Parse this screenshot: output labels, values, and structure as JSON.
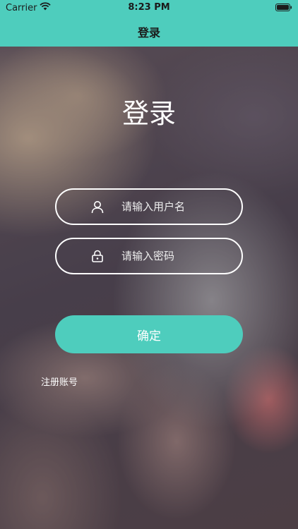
{
  "status_bar": {
    "carrier": "Carrier",
    "time": "8:23 PM"
  },
  "nav": {
    "title": "登录"
  },
  "login": {
    "heading": "登录",
    "username_placeholder": "请输入用户名",
    "password_placeholder": "请输入密码",
    "confirm_label": "确定",
    "register_label": "注册账号"
  },
  "colors": {
    "accent": "#4ecdbd"
  },
  "icons": {
    "wifi": "wifi-icon",
    "battery": "battery-icon",
    "user": "user-icon",
    "lock": "lock-icon"
  }
}
